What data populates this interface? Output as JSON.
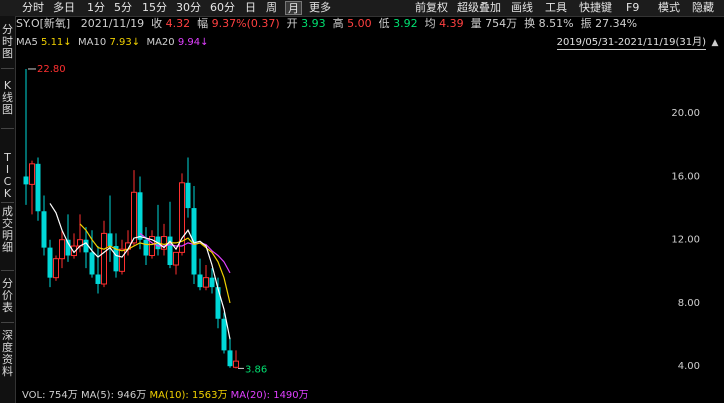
{
  "toolbar": {
    "tabs": [
      "分时",
      "多日",
      "1分",
      "5分",
      "15分",
      "30分",
      "60分",
      "日",
      "周",
      "月",
      "更多"
    ],
    "active_index": 9,
    "right_items": [
      "前复权",
      "超级叠加",
      "画线",
      "工具",
      "快捷键",
      "F9",
      "模式",
      "隐藏"
    ]
  },
  "info": {
    "symbol": "SY.O[新氧]",
    "date": "2021/11/19",
    "close_label": "收",
    "close_value": "4.32",
    "change_label": "幅",
    "change_value": "9.37%(0.37)",
    "open_label": "开",
    "open_value": "3.93",
    "high_label": "高",
    "high_value": "5.00",
    "low_label": "低",
    "low_value": "3.92",
    "avg_label": "均",
    "avg_value": "4.39",
    "vol_label": "量",
    "vol_value": "754万",
    "turnover_label": "换",
    "turnover_value": "8.51%",
    "amplitude_label": "振",
    "amplitude_value": "27.34%"
  },
  "sidebar": {
    "items": [
      "分时图",
      "K线图",
      "TICK",
      "成交明细",
      "分价表",
      "深度资料"
    ]
  },
  "ma": {
    "ma5_label": "MA5",
    "ma5_value": "5.11↓",
    "ma10_label": "MA10",
    "ma10_value": "7.93↓",
    "ma20_label": "MA20",
    "ma20_value": "9.94↓"
  },
  "range": "2019/05/31-2021/11/19(31月)",
  "collapse_icon": "chevron-up-icon",
  "y_axis_labels": [
    "20.00",
    "16.00",
    "12.00",
    "8.00",
    "4.00"
  ],
  "annotations": {
    "high": "22.80",
    "low": "3.86"
  },
  "volume": {
    "vol_label": "VOL:",
    "vol_value": "754万",
    "ma5_label": "MA(5):",
    "ma5_value": "946万",
    "ma10_label": "MA(10):",
    "ma10_value": "1563万",
    "ma20_label": "MA(20):",
    "ma20_value": "1490万"
  },
  "colors": {
    "up": "#ff3030",
    "down": "#00d8d8",
    "ma5": "#ffffff",
    "ma10": "#f0d000",
    "ma20": "#e040ff"
  },
  "chart_data": {
    "type": "candlestick",
    "ylim": [
      3.0,
      24.0
    ],
    "candles": [
      {
        "o": 16.0,
        "h": 22.8,
        "c": 15.5,
        "l": 14.2
      },
      {
        "o": 15.5,
        "h": 17.0,
        "c": 16.8,
        "l": 13.6
      },
      {
        "o": 16.8,
        "h": 17.2,
        "c": 13.8,
        "l": 13.2
      },
      {
        "o": 13.8,
        "h": 14.8,
        "c": 11.5,
        "l": 11.0
      },
      {
        "o": 11.5,
        "h": 12.0,
        "c": 9.6,
        "l": 9.0
      },
      {
        "o": 9.6,
        "h": 11.0,
        "c": 10.8,
        "l": 9.4
      },
      {
        "o": 10.8,
        "h": 12.6,
        "c": 12.0,
        "l": 10.2
      },
      {
        "o": 12.0,
        "h": 13.6,
        "c": 11.0,
        "l": 10.6
      },
      {
        "o": 11.0,
        "h": 12.4,
        "c": 11.6,
        "l": 10.8
      },
      {
        "o": 11.6,
        "h": 13.6,
        "c": 12.0,
        "l": 11.2
      },
      {
        "o": 12.0,
        "h": 12.8,
        "c": 11.2,
        "l": 10.2
      },
      {
        "o": 11.2,
        "h": 12.6,
        "c": 9.8,
        "l": 9.6
      },
      {
        "o": 9.8,
        "h": 11.6,
        "c": 9.2,
        "l": 8.6
      },
      {
        "o": 9.2,
        "h": 13.2,
        "c": 12.4,
        "l": 9.0
      },
      {
        "o": 12.4,
        "h": 14.8,
        "c": 11.6,
        "l": 10.6
      },
      {
        "o": 11.6,
        "h": 12.4,
        "c": 10.0,
        "l": 9.6
      },
      {
        "o": 10.0,
        "h": 12.0,
        "c": 11.4,
        "l": 9.8
      },
      {
        "o": 11.4,
        "h": 12.6,
        "c": 11.8,
        "l": 11.0
      },
      {
        "o": 11.8,
        "h": 16.4,
        "c": 15.0,
        "l": 11.6
      },
      {
        "o": 15.0,
        "h": 16.0,
        "c": 12.0,
        "l": 11.4
      },
      {
        "o": 12.0,
        "h": 12.8,
        "c": 11.0,
        "l": 10.4
      },
      {
        "o": 11.0,
        "h": 12.6,
        "c": 12.2,
        "l": 10.8
      },
      {
        "o": 12.2,
        "h": 14.2,
        "c": 11.4,
        "l": 11.0
      },
      {
        "o": 11.4,
        "h": 13.0,
        "c": 12.2,
        "l": 11.0
      },
      {
        "o": 12.2,
        "h": 14.4,
        "c": 10.4,
        "l": 10.2
      },
      {
        "o": 10.4,
        "h": 11.2,
        "c": 11.2,
        "l": 9.8
      },
      {
        "o": 11.2,
        "h": 16.2,
        "c": 15.6,
        "l": 11.0
      },
      {
        "o": 15.6,
        "h": 17.2,
        "c": 14.0,
        "l": 13.4
      },
      {
        "o": 14.0,
        "h": 15.4,
        "c": 9.8,
        "l": 9.2
      },
      {
        "o": 9.8,
        "h": 10.8,
        "c": 9.0,
        "l": 8.8
      },
      {
        "o": 9.0,
        "h": 10.4,
        "c": 9.6,
        "l": 8.8
      },
      {
        "o": 9.6,
        "h": 10.2,
        "c": 9.0,
        "l": 8.6
      },
      {
        "o": 9.0,
        "h": 9.6,
        "c": 7.0,
        "l": 6.4
      },
      {
        "o": 7.0,
        "h": 7.4,
        "c": 5.0,
        "l": 4.8
      },
      {
        "o": 5.0,
        "h": 5.8,
        "c": 4.0,
        "l": 3.9
      },
      {
        "o": 3.93,
        "h": 5.0,
        "c": 4.32,
        "l": 3.86
      }
    ],
    "ma5": [
      null,
      null,
      null,
      null,
      14.3,
      13.7,
      12.6,
      11.8,
      11.2,
      11.6,
      11.8,
      11.3,
      10.9,
      11.2,
      11.5,
      11.0,
      10.9,
      11.4,
      12.1,
      12.2,
      12.1,
      12.0,
      11.8,
      11.5,
      11.9,
      11.4,
      12.1,
      12.6,
      11.8,
      11.9,
      11.6,
      10.4,
      8.9,
      7.6,
      5.7
    ],
    "ma10": [
      null,
      null,
      null,
      null,
      null,
      null,
      null,
      null,
      null,
      13.0,
      12.6,
      12.0,
      11.5,
      11.4,
      11.6,
      11.4,
      11.3,
      11.4,
      11.6,
      11.8,
      11.7,
      11.7,
      11.8,
      11.7,
      11.8,
      11.8,
      11.9,
      12.1,
      11.7,
      11.8,
      11.5,
      11.2,
      10.6,
      9.6,
      8.0
    ],
    "ma20": [
      null,
      null,
      null,
      null,
      null,
      null,
      null,
      null,
      null,
      null,
      null,
      null,
      null,
      null,
      null,
      null,
      null,
      null,
      null,
      12.4,
      12.1,
      11.8,
      11.6,
      11.6,
      11.7,
      11.6,
      11.6,
      11.8,
      11.7,
      11.8,
      11.7,
      11.3,
      11.0,
      10.6,
      9.9
    ]
  }
}
